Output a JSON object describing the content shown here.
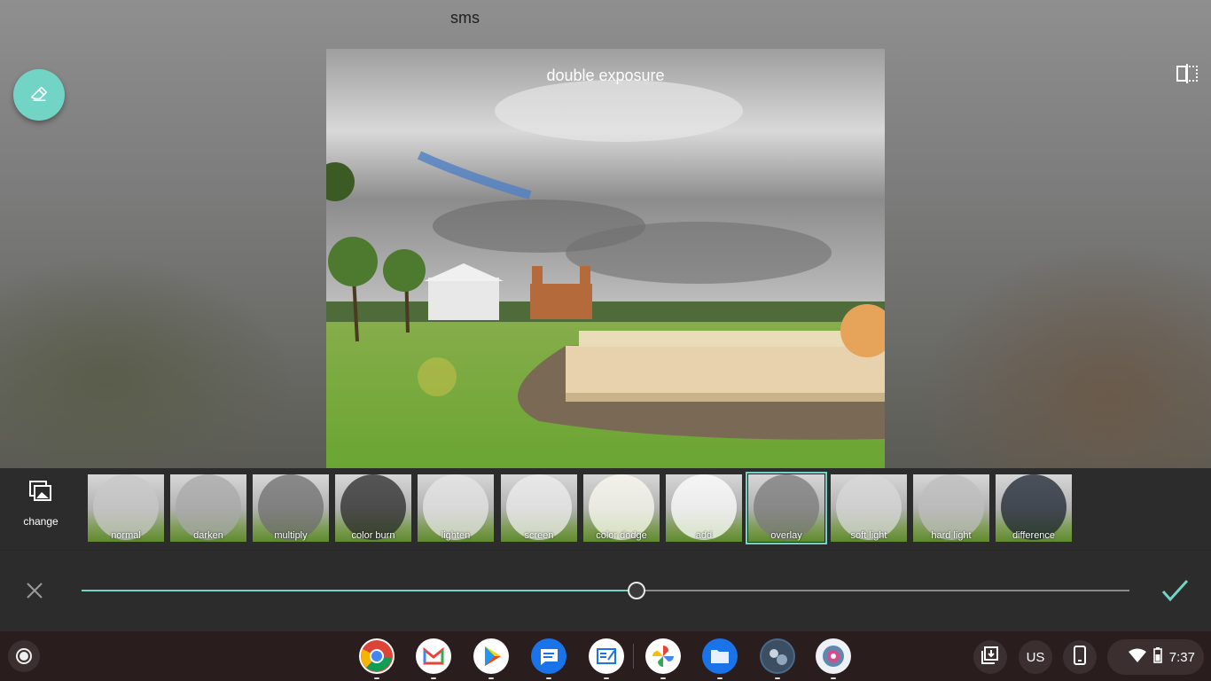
{
  "app": {
    "title": "sms"
  },
  "editor": {
    "photo_label": "double exposure",
    "change_label": "change",
    "blend_modes": [
      {
        "label": "normal",
        "selected": false
      },
      {
        "label": "darken",
        "selected": false
      },
      {
        "label": "multiply",
        "selected": false
      },
      {
        "label": "color burn",
        "selected": false
      },
      {
        "label": "lighten",
        "selected": false
      },
      {
        "label": "screen",
        "selected": false
      },
      {
        "label": "color dodge",
        "selected": false
      },
      {
        "label": "add",
        "selected": false
      },
      {
        "label": "overlay",
        "selected": true
      },
      {
        "label": "soft light",
        "selected": false
      },
      {
        "label": "hard light",
        "selected": false
      },
      {
        "label": "difference",
        "selected": false
      }
    ],
    "opacity_fraction": 0.53,
    "accent_color": "#72d4c4",
    "icons": {
      "eraser": "eraser-icon",
      "compare": "compare-icon",
      "change": "change-image-icon",
      "cancel": "close-icon",
      "confirm": "checkmark-icon"
    }
  },
  "shelf": {
    "apps": [
      {
        "name": "chrome-app-icon",
        "color": "#db4437"
      },
      {
        "name": "gmail-app-icon",
        "color": "#ea4335"
      },
      {
        "name": "play-store-app-icon",
        "color": "#00c853"
      },
      {
        "name": "messages-app-icon",
        "color": "#1a73e8"
      },
      {
        "name": "news-app-icon",
        "color": "#ffffff"
      },
      {
        "name": "photos-app-icon",
        "color": "#fbbc04"
      },
      {
        "name": "files-app-icon",
        "color": "#1a73e8"
      },
      {
        "name": "wallpaper-app-icon",
        "color": "#4a6a8a"
      },
      {
        "name": "camera-app-icon",
        "color": "#a0c0e0"
      }
    ],
    "keyboard_layout": "US",
    "time": "7:37"
  }
}
